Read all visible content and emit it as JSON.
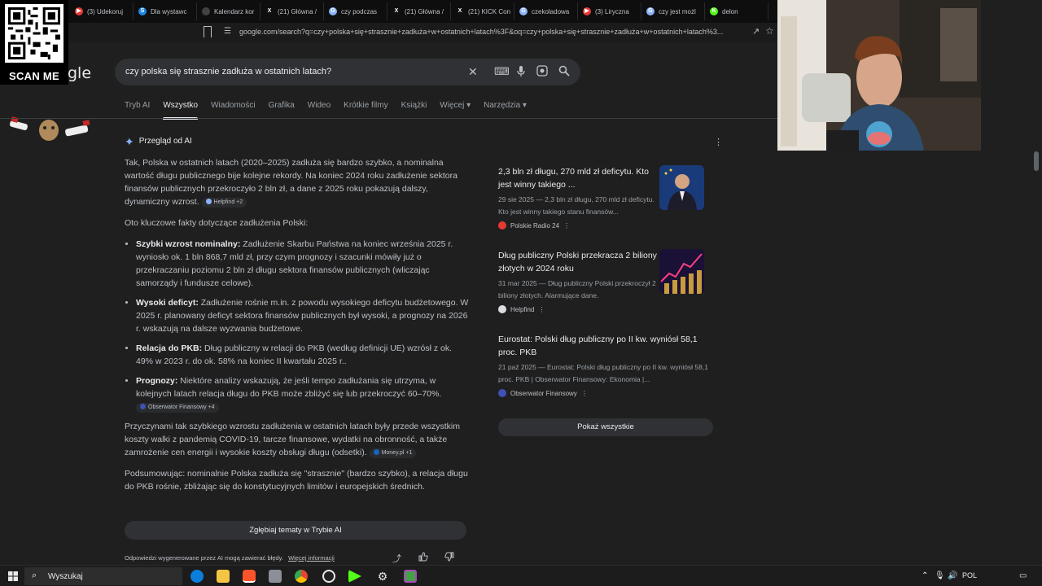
{
  "browser": {
    "tabs": [
      {
        "label": "(3) Udekoruj",
        "color": "#e53935",
        "glyph": "▶"
      },
      {
        "label": "Dla wystawc",
        "color": "#1e88e5",
        "glyph": "S"
      },
      {
        "label": "Kalendarz kor",
        "color": "#424242",
        "glyph": ""
      },
      {
        "label": "(21) Główna /",
        "color": "#111111",
        "glyph": "X"
      },
      {
        "label": "czy podczas",
        "color": "#8ab4f8",
        "glyph": "G"
      },
      {
        "label": "(21) Główna /",
        "color": "#111111",
        "glyph": "X"
      },
      {
        "label": "(21) KICK Con",
        "color": "#111111",
        "glyph": "X"
      },
      {
        "label": "czekoladowa",
        "color": "#8ab4f8",
        "glyph": "G"
      },
      {
        "label": "(3) Liryczna",
        "color": "#e53935",
        "glyph": "▶"
      },
      {
        "label": "czy jest możl",
        "color": "#8ab4f8",
        "glyph": "G"
      },
      {
        "label": "delon",
        "color": "#53fc18",
        "glyph": "K"
      }
    ],
    "url": "google.com/search?q=czy+polska+się+strasznie+zadłuża+w+ostatnich+latach%3F&oq=czy+polska+się+strasznie+zadłuża+w+ostatnich+latach%3..."
  },
  "overlay": {
    "qr_label": "SCAN ME",
    "logo_fragment": "gle"
  },
  "search": {
    "query": "czy polska się strasznie zadłuża w ostatnich latach?"
  },
  "nav_tabs": [
    "Tryb AI",
    "Wszystko",
    "Wiadomości",
    "Grafika",
    "Wideo",
    "Krótkie filmy",
    "Książki",
    "Więcej ▾",
    "Narzędzia ▾"
  ],
  "ai_overview": {
    "header": "Przegląd od AI",
    "intro": "Tak, Polska w ostatnich latach (2020–2025) zadłuża się bardzo szybko, a nominalna wartość długu publicznego bije kolejne rekordy. Na koniec 2024 roku zadłużenie sektora finansów publicznych przekroczyło 2 bln zł, a dane z 2025 roku pokazują dalszy, dynamiczny wzrost.",
    "intro_chip": "Helpfind +2",
    "key_facts": "Oto kluczowe fakty dotyczące zadłużenia Polski:",
    "bullets": [
      {
        "bold": "Szybki wzrost nominalny:",
        "text": " Zadłużenie Skarbu Państwa na koniec września 2025 r. wyniosło ok. 1 bln 868,7 mld zł, przy czym prognozy i szacunki mówiły już o przekraczaniu poziomu 2 bln zł długu sektora finansów publicznych (wliczając samorządy i fundusze celowe)."
      },
      {
        "bold": "Wysoki deficyt:",
        "text": " Zadłużenie rośnie m.in. z powodu wysokiego deficytu budżetowego. W 2025 r. planowany deficyt sektora finansów publicznych był wysoki, a prognozy na 2026 r. wskazują na dalsze wyzwania budżetowe."
      },
      {
        "bold": "Relacja do PKB:",
        "text": " Dług publiczny w relacji do PKB (według definicji UE) wzrósł z ok. 49% w 2023 r. do ok. 58% na koniec II kwartału 2025 r.."
      },
      {
        "bold": "Prognozy:",
        "text": " Niektóre analizy wskazują, że jeśli tempo zadłużania się utrzyma, w kolejnych latach relacja długu do PKB może zbliżyć się lub przekroczyć 60–70%."
      }
    ],
    "bullet4_chip": "Obserwator Finansowy +4",
    "causes": "Przyczynami tak szybkiego wzrostu zadłużenia w ostatnich latach były przede wszystkim koszty walki z pandemią COVID-19, tarcze finansowe, wydatki na obronność, a także zamrożenie cen energii i wysokie koszty obsługi długu (odsetki).",
    "causes_chip": "Money.pl +1",
    "summary": "Podsumowując: nominalnie Polska zadłuża się \"strasznie\" (bardzo szybko), a relacja długu do PKB rośnie, zbliżając się do konstytucyjnych limitów i europejskich średnich.",
    "deeper_button": "Zgłębiaj tematy w Trybie AI",
    "disclaimer": "Odpowiedzi wygenerowane przez AI mogą zawierać błędy.",
    "disclaimer_link": "Więcej informacji"
  },
  "sources": [
    {
      "title": "2,3 bln zł długu, 270 mld zł deficytu. Kto jest winny takiego ...",
      "desc": "29 sie 2025 — 2,3 bln zł długu, 270 mld zł deficytu. Kto jest winny takiego stanu finansów...",
      "site": "Polskie Radio 24",
      "site_color": "#e53935"
    },
    {
      "title": "Dług publiczny Polski przekracza 2 biliony złotych w 2024 roku",
      "desc": "31 mar 2025 — Dług publiczny Polski przekroczył 2 biliony złotych. Alarmujące dane.",
      "site": "Helpfind",
      "site_color": "#dadce0"
    },
    {
      "title": "Eurostat: Polski dług publiczny po II kw. wyniósł 58,1 proc. PKB",
      "desc": "21 paź 2025 — Eurostat: Polski dług publiczny po II kw. wyniósł 58,1 proc. PKB | Obserwator Finansowy: Ekonomia |...",
      "site": "Obserwator Finansowy",
      "site_color": "#3f51b5"
    }
  ],
  "show_all": "Pokaż wszystkie",
  "taskbar": {
    "search_label": "Wyszukaj",
    "lang": "POL"
  }
}
